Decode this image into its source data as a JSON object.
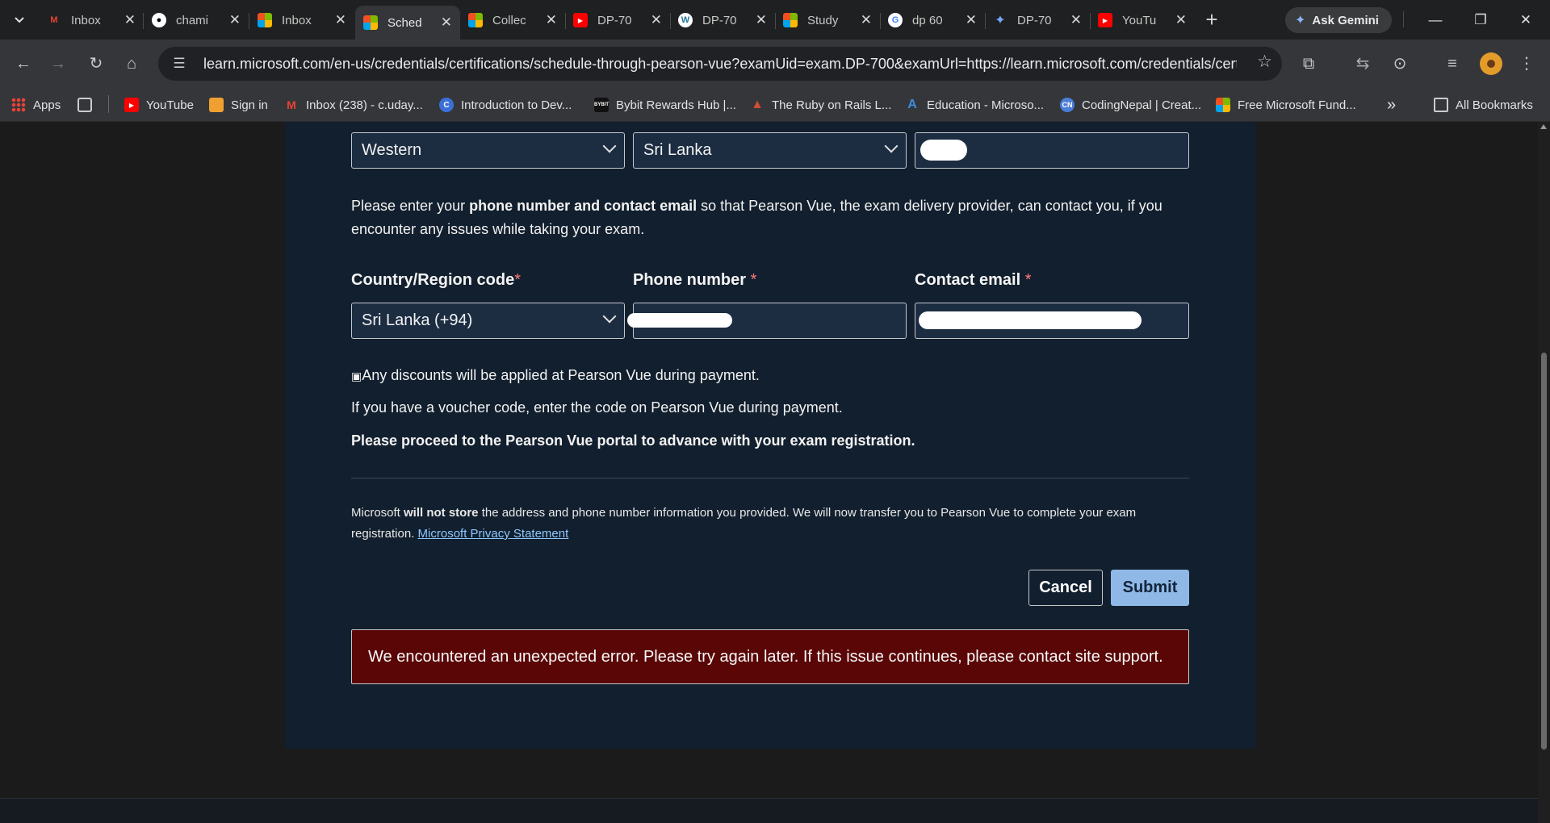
{
  "browser": {
    "tabs": [
      {
        "title": "Inbox",
        "icon": "gmail-icon"
      },
      {
        "title": "chami",
        "icon": "github-icon"
      },
      {
        "title": "Inbox",
        "icon": "microsoft-icon"
      },
      {
        "title": "Sched",
        "icon": "microsoft-icon",
        "active": true
      },
      {
        "title": "Collec",
        "icon": "microsoft-icon"
      },
      {
        "title": "DP-70",
        "icon": "youtube-icon"
      },
      {
        "title": "DP-70",
        "icon": "wordpress-icon"
      },
      {
        "title": "Study",
        "icon": "microsoft-icon"
      },
      {
        "title": "dp 60",
        "icon": "google-icon"
      },
      {
        "title": "DP-70",
        "icon": "gemini-icon"
      },
      {
        "title": "YouTu",
        "icon": "youtube-icon"
      }
    ],
    "gemini_label": "Ask Gemini",
    "url": "learn.microsoft.com/en-us/credentials/certifications/schedule-through-pearson-vue?examUid=exam.DP-700&examUrl=https://learn.microsoft.com/credentials/certifi...",
    "bookmarks": [
      {
        "label": "Apps",
        "icon": "apps-grid-icon"
      },
      {
        "label": "YouTube",
        "icon": "youtube-icon"
      },
      {
        "label": "Sign in",
        "icon": "box-icon"
      },
      {
        "label": "Inbox (238) - c.uday...",
        "icon": "gmail-icon"
      },
      {
        "label": "Introduction to Dev...",
        "icon": "c-icon"
      },
      {
        "label": "Bybit Rewards Hub |...",
        "icon": "bybit-icon"
      },
      {
        "label": "The Ruby on Rails L...",
        "icon": "rails-icon"
      },
      {
        "label": "Education - Microso...",
        "icon": "azure-icon"
      },
      {
        "label": "CodingNepal | Creat...",
        "icon": "codingnepal-icon"
      },
      {
        "label": "Free Microsoft Fund...",
        "icon": "microsoft-icon"
      }
    ],
    "all_bookmarks": "All Bookmarks"
  },
  "form": {
    "state_value": "Western",
    "country_value": "Sri Lanka",
    "contact_intro_prefix": "Please enter your ",
    "contact_intro_bold": "phone number and contact email",
    "contact_intro_suffix": " so that Pearson Vue, the exam delivery provider, can contact you, if you encounter any issues while taking your exam.",
    "country_code_label": "Country/Region code",
    "phone_label": "Phone number ",
    "email_label": "Contact email ",
    "required_mark": "*",
    "country_code_value": "Sri Lanka (+94)",
    "discount_note": "Any discounts will be applied at Pearson Vue during payment.",
    "voucher_note": "If you have a voucher code, enter the code on Pearson Vue during payment.",
    "proceed_note": "Please proceed to the Pearson Vue portal to advance with your exam registration.",
    "privacy_prefix": "Microsoft ",
    "privacy_bold": "will not store",
    "privacy_suffix": " the address and phone number information you provided. We will now transfer you to Pearson Vue to complete your exam registration. ",
    "privacy_link": "Microsoft Privacy Statement",
    "cancel_label": "Cancel",
    "submit_label": "Submit",
    "error_message": "We encountered an unexpected error. Please try again later. If this issue continues, please contact site support."
  }
}
